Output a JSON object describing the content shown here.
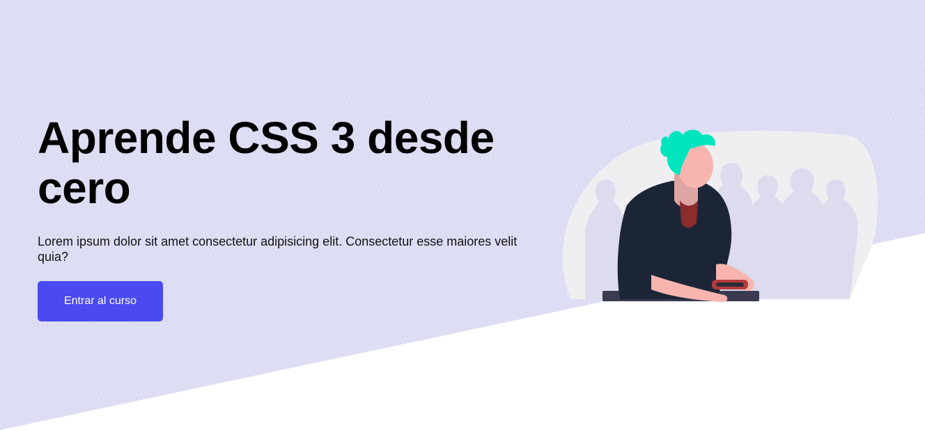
{
  "hero": {
    "title": "Aprende CSS 3 desde cero",
    "description": "Lorem ipsum dolor sit amet consectetur adipisicing elit. Consectetur esse maiores velit quia?",
    "cta_label": "Entrar al curso"
  },
  "colors": {
    "background_tint": "#dcdcf2",
    "button": "#4a4af0",
    "hair": "#00e5be",
    "jacket": "#1c2536",
    "skin": "#f8b5b0"
  },
  "icons": {
    "illustration": "person-with-game-controller"
  }
}
